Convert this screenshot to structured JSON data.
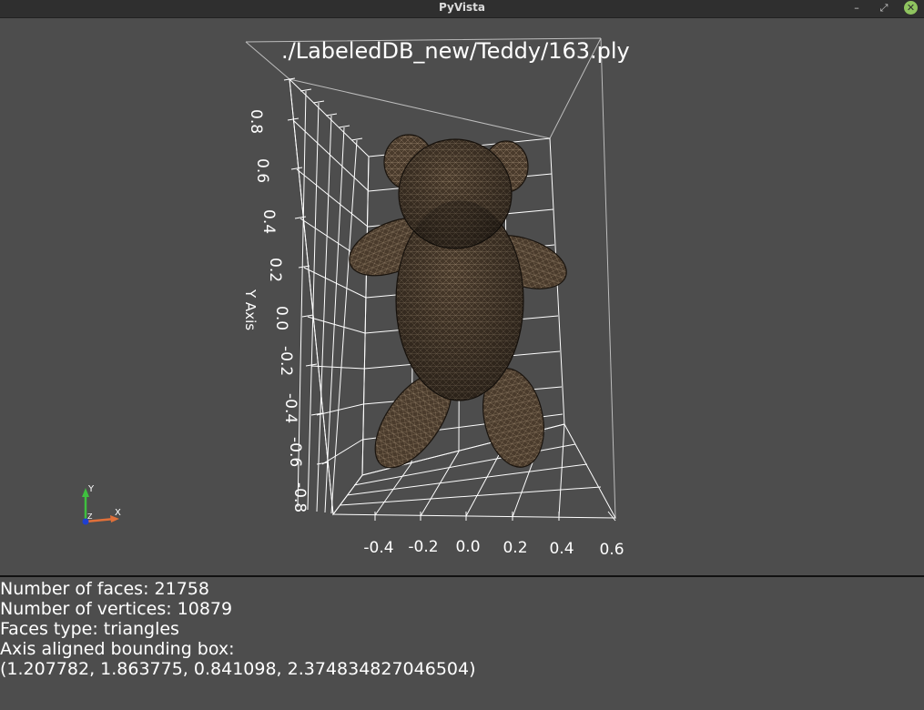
{
  "window": {
    "title": "PyVista"
  },
  "plot": {
    "title": "./LabeledDB_new/Teddy/163.ply",
    "y_axis_label": "Y Axis",
    "y_ticks": [
      "0.8",
      "0.6",
      "0.4",
      "0.2",
      "0.0",
      "-0.2",
      "-0.4",
      "-0.6",
      "-0.8"
    ],
    "x_ticks": [
      "-0.4",
      "-0.2",
      "0.0",
      "0.2",
      "0.4",
      "0.6"
    ],
    "orientation_widget": {
      "y": "Y",
      "x": "X",
      "z": "Z"
    },
    "mesh": {
      "object": "teddy bear",
      "color": "#4a3b2c",
      "wire_color": "#a89378"
    }
  },
  "info": {
    "faces": "Number of faces: 21758",
    "vertices": "Number of vertices: 10879",
    "faces_type": "Faces type: triangles",
    "bbox_label": "Axis aligned bounding box:",
    "bbox_value": "(1.207782, 1.863775, 0.841098, 2.374834827046504)"
  },
  "colors": {
    "background": "#4d4d4d",
    "titlebar": "#2f2f2f",
    "grid": "#ffffff",
    "close_button": "#8fc45f"
  }
}
